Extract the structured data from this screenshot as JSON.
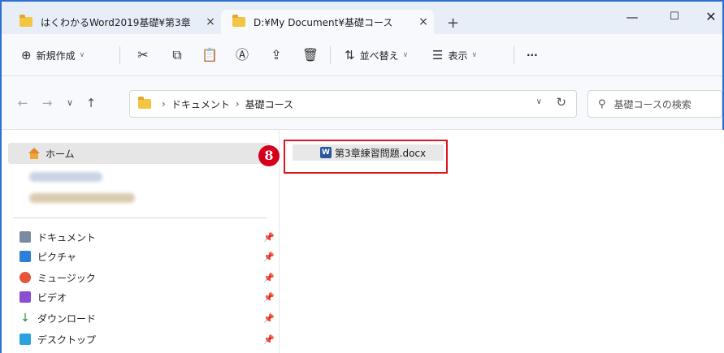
{
  "tabs": [
    {
      "title": "はくわかるWord2019基礎¥第3章",
      "close": "×"
    },
    {
      "title": "D:¥My Document¥基礎コース",
      "close": "×"
    }
  ],
  "new_tab_label": "+",
  "window_controls": {
    "minimize": "—",
    "maximize": "☐",
    "close": "✕"
  },
  "toolbar": {
    "new_label": "新規作成",
    "sort_label": "並べ替え",
    "view_label": "表示",
    "more_label": "···"
  },
  "address": {
    "crumbs": [
      "ドキュメント",
      "基礎コース"
    ],
    "separator": "›"
  },
  "search": {
    "placeholder": "基礎コースの検索"
  },
  "sidebar": {
    "home_label": "ホーム",
    "quick_access": [
      {
        "label": "ドキュメント",
        "icon": "document-icon",
        "color": "#7a8aa0"
      },
      {
        "label": "ピクチャ",
        "icon": "pictures-icon",
        "color": "#2f7fd8"
      },
      {
        "label": "ミュージック",
        "icon": "music-icon",
        "color": "#e4553a"
      },
      {
        "label": "ビデオ",
        "icon": "video-icon",
        "color": "#8a4fd0"
      },
      {
        "label": "ダウンロード",
        "icon": "download-icon",
        "color": "#1e8e3e"
      },
      {
        "label": "デスクトップ",
        "icon": "desktop-icon",
        "color": "#2aa2e0"
      }
    ],
    "pin_glyph": "📌"
  },
  "files": [
    {
      "name": "第3章練習問題.docx",
      "icon": "word-doc-icon"
    }
  ],
  "step_badge": "8",
  "colors": {
    "accent": "#2e6fd4",
    "highlight_border": "#e0161e",
    "badge": "#d6001c",
    "folder": "#f4c542"
  }
}
